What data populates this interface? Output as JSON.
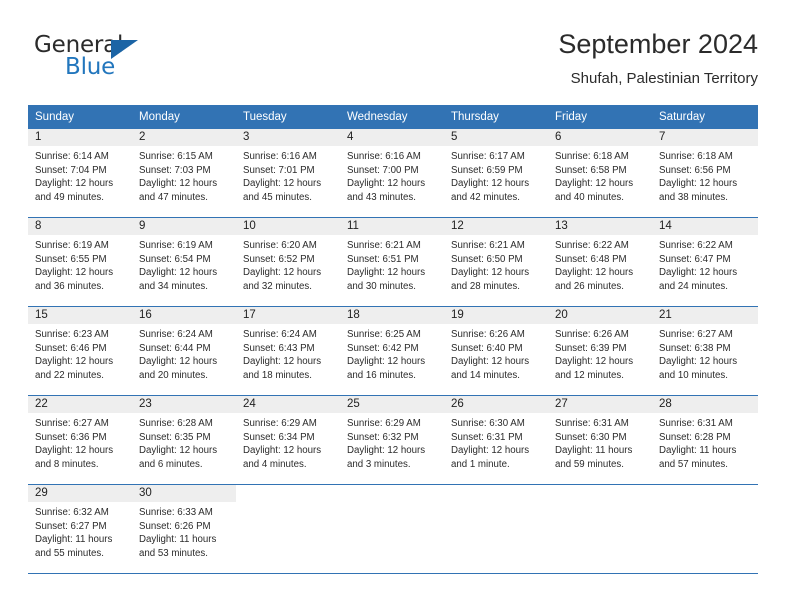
{
  "brand": {
    "line1": "General",
    "line2": "Blue",
    "triangle_icon": "triangle-icon",
    "colors": {
      "dark": "#2b2b2b",
      "blue": "#2276bd",
      "triangle": "#1b64a5"
    }
  },
  "header": {
    "title": "September 2024",
    "subtitle": "Shufah, Palestinian Territory"
  },
  "theme": {
    "header_blue": "#3273b4",
    "daynum_band": "#eeeeee",
    "text": "#2b2b2b"
  },
  "weekday_headers": [
    "Sunday",
    "Monday",
    "Tuesday",
    "Wednesday",
    "Thursday",
    "Friday",
    "Saturday"
  ],
  "weeks": [
    [
      {
        "day": "1",
        "sunrise": "Sunrise: 6:14 AM",
        "sunset": "Sunset: 7:04 PM",
        "daylight1": "Daylight: 12 hours",
        "daylight2": "and 49 minutes."
      },
      {
        "day": "2",
        "sunrise": "Sunrise: 6:15 AM",
        "sunset": "Sunset: 7:03 PM",
        "daylight1": "Daylight: 12 hours",
        "daylight2": "and 47 minutes."
      },
      {
        "day": "3",
        "sunrise": "Sunrise: 6:16 AM",
        "sunset": "Sunset: 7:01 PM",
        "daylight1": "Daylight: 12 hours",
        "daylight2": "and 45 minutes."
      },
      {
        "day": "4",
        "sunrise": "Sunrise: 6:16 AM",
        "sunset": "Sunset: 7:00 PM",
        "daylight1": "Daylight: 12 hours",
        "daylight2": "and 43 minutes."
      },
      {
        "day": "5",
        "sunrise": "Sunrise: 6:17 AM",
        "sunset": "Sunset: 6:59 PM",
        "daylight1": "Daylight: 12 hours",
        "daylight2": "and 42 minutes."
      },
      {
        "day": "6",
        "sunrise": "Sunrise: 6:18 AM",
        "sunset": "Sunset: 6:58 PM",
        "daylight1": "Daylight: 12 hours",
        "daylight2": "and 40 minutes."
      },
      {
        "day": "7",
        "sunrise": "Sunrise: 6:18 AM",
        "sunset": "Sunset: 6:56 PM",
        "daylight1": "Daylight: 12 hours",
        "daylight2": "and 38 minutes."
      }
    ],
    [
      {
        "day": "8",
        "sunrise": "Sunrise: 6:19 AM",
        "sunset": "Sunset: 6:55 PM",
        "daylight1": "Daylight: 12 hours",
        "daylight2": "and 36 minutes."
      },
      {
        "day": "9",
        "sunrise": "Sunrise: 6:19 AM",
        "sunset": "Sunset: 6:54 PM",
        "daylight1": "Daylight: 12 hours",
        "daylight2": "and 34 minutes."
      },
      {
        "day": "10",
        "sunrise": "Sunrise: 6:20 AM",
        "sunset": "Sunset: 6:52 PM",
        "daylight1": "Daylight: 12 hours",
        "daylight2": "and 32 minutes."
      },
      {
        "day": "11",
        "sunrise": "Sunrise: 6:21 AM",
        "sunset": "Sunset: 6:51 PM",
        "daylight1": "Daylight: 12 hours",
        "daylight2": "and 30 minutes."
      },
      {
        "day": "12",
        "sunrise": "Sunrise: 6:21 AM",
        "sunset": "Sunset: 6:50 PM",
        "daylight1": "Daylight: 12 hours",
        "daylight2": "and 28 minutes."
      },
      {
        "day": "13",
        "sunrise": "Sunrise: 6:22 AM",
        "sunset": "Sunset: 6:48 PM",
        "daylight1": "Daylight: 12 hours",
        "daylight2": "and 26 minutes."
      },
      {
        "day": "14",
        "sunrise": "Sunrise: 6:22 AM",
        "sunset": "Sunset: 6:47 PM",
        "daylight1": "Daylight: 12 hours",
        "daylight2": "and 24 minutes."
      }
    ],
    [
      {
        "day": "15",
        "sunrise": "Sunrise: 6:23 AM",
        "sunset": "Sunset: 6:46 PM",
        "daylight1": "Daylight: 12 hours",
        "daylight2": "and 22 minutes."
      },
      {
        "day": "16",
        "sunrise": "Sunrise: 6:24 AM",
        "sunset": "Sunset: 6:44 PM",
        "daylight1": "Daylight: 12 hours",
        "daylight2": "and 20 minutes."
      },
      {
        "day": "17",
        "sunrise": "Sunrise: 6:24 AM",
        "sunset": "Sunset: 6:43 PM",
        "daylight1": "Daylight: 12 hours",
        "daylight2": "and 18 minutes."
      },
      {
        "day": "18",
        "sunrise": "Sunrise: 6:25 AM",
        "sunset": "Sunset: 6:42 PM",
        "daylight1": "Daylight: 12 hours",
        "daylight2": "and 16 minutes."
      },
      {
        "day": "19",
        "sunrise": "Sunrise: 6:26 AM",
        "sunset": "Sunset: 6:40 PM",
        "daylight1": "Daylight: 12 hours",
        "daylight2": "and 14 minutes."
      },
      {
        "day": "20",
        "sunrise": "Sunrise: 6:26 AM",
        "sunset": "Sunset: 6:39 PM",
        "daylight1": "Daylight: 12 hours",
        "daylight2": "and 12 minutes."
      },
      {
        "day": "21",
        "sunrise": "Sunrise: 6:27 AM",
        "sunset": "Sunset: 6:38 PM",
        "daylight1": "Daylight: 12 hours",
        "daylight2": "and 10 minutes."
      }
    ],
    [
      {
        "day": "22",
        "sunrise": "Sunrise: 6:27 AM",
        "sunset": "Sunset: 6:36 PM",
        "daylight1": "Daylight: 12 hours",
        "daylight2": "and 8 minutes."
      },
      {
        "day": "23",
        "sunrise": "Sunrise: 6:28 AM",
        "sunset": "Sunset: 6:35 PM",
        "daylight1": "Daylight: 12 hours",
        "daylight2": "and 6 minutes."
      },
      {
        "day": "24",
        "sunrise": "Sunrise: 6:29 AM",
        "sunset": "Sunset: 6:34 PM",
        "daylight1": "Daylight: 12 hours",
        "daylight2": "and 4 minutes."
      },
      {
        "day": "25",
        "sunrise": "Sunrise: 6:29 AM",
        "sunset": "Sunset: 6:32 PM",
        "daylight1": "Daylight: 12 hours",
        "daylight2": "and 3 minutes."
      },
      {
        "day": "26",
        "sunrise": "Sunrise: 6:30 AM",
        "sunset": "Sunset: 6:31 PM",
        "daylight1": "Daylight: 12 hours",
        "daylight2": "and 1 minute."
      },
      {
        "day": "27",
        "sunrise": "Sunrise: 6:31 AM",
        "sunset": "Sunset: 6:30 PM",
        "daylight1": "Daylight: 11 hours",
        "daylight2": "and 59 minutes."
      },
      {
        "day": "28",
        "sunrise": "Sunrise: 6:31 AM",
        "sunset": "Sunset: 6:28 PM",
        "daylight1": "Daylight: 11 hours",
        "daylight2": "and 57 minutes."
      }
    ],
    [
      {
        "day": "29",
        "sunrise": "Sunrise: 6:32 AM",
        "sunset": "Sunset: 6:27 PM",
        "daylight1": "Daylight: 11 hours",
        "daylight2": "and 55 minutes."
      },
      {
        "day": "30",
        "sunrise": "Sunrise: 6:33 AM",
        "sunset": "Sunset: 6:26 PM",
        "daylight1": "Daylight: 11 hours",
        "daylight2": "and 53 minutes."
      },
      {
        "day": "",
        "sunrise": "",
        "sunset": "",
        "daylight1": "",
        "daylight2": ""
      },
      {
        "day": "",
        "sunrise": "",
        "sunset": "",
        "daylight1": "",
        "daylight2": ""
      },
      {
        "day": "",
        "sunrise": "",
        "sunset": "",
        "daylight1": "",
        "daylight2": ""
      },
      {
        "day": "",
        "sunrise": "",
        "sunset": "",
        "daylight1": "",
        "daylight2": ""
      },
      {
        "day": "",
        "sunrise": "",
        "sunset": "",
        "daylight1": "",
        "daylight2": ""
      }
    ]
  ]
}
